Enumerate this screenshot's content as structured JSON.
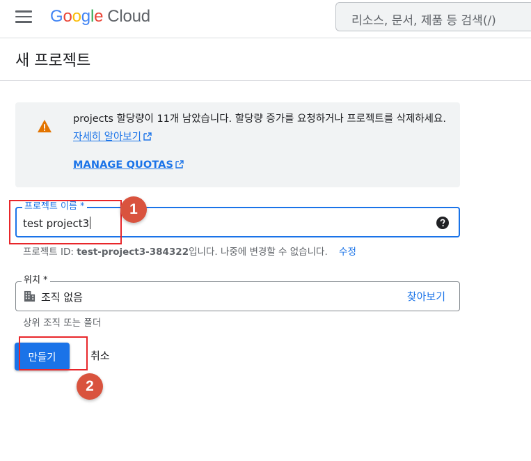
{
  "header": {
    "logo_letters": [
      "G",
      "o",
      "o",
      "g",
      "l",
      "e"
    ],
    "logo_colors": [
      "#4285F4",
      "#EA4335",
      "#FBBC05",
      "#4285F4",
      "#34A853",
      "#EA4335"
    ],
    "logo_product": "Cloud",
    "search_placeholder": "리소스, 문서, 제품 등 검색(/)"
  },
  "page": {
    "title": "새 프로젝트"
  },
  "alert": {
    "icon": "warning-icon",
    "message": "projects 할당량이 11개 남았습니다. 할당량 증가를 요청하거나 프로젝트를 삭제하세요.",
    "learn_more": "자세히 알아보기",
    "manage_quotas": "MANAGE QUOTAS"
  },
  "form": {
    "project_name": {
      "label": "프로젝트 이름 *",
      "value": "test project3",
      "help_icon": "help-icon"
    },
    "project_id_hint": {
      "prefix": "프로젝트 ID:",
      "id": "test-project3-384322",
      "suffix": "입니다. 나중에 변경할 수 없습니다.",
      "edit": "수정"
    },
    "location": {
      "label": "위치 *",
      "value": "조직 없음",
      "icon": "building-icon",
      "browse": "찾아보기",
      "hint": "상위 조직 또는 폴더"
    }
  },
  "buttons": {
    "create": "만들기",
    "cancel": "취소"
  },
  "annotations": {
    "badge1": "1",
    "badge2": "2",
    "color": "#d9533e",
    "box_color": "#e8262a"
  }
}
